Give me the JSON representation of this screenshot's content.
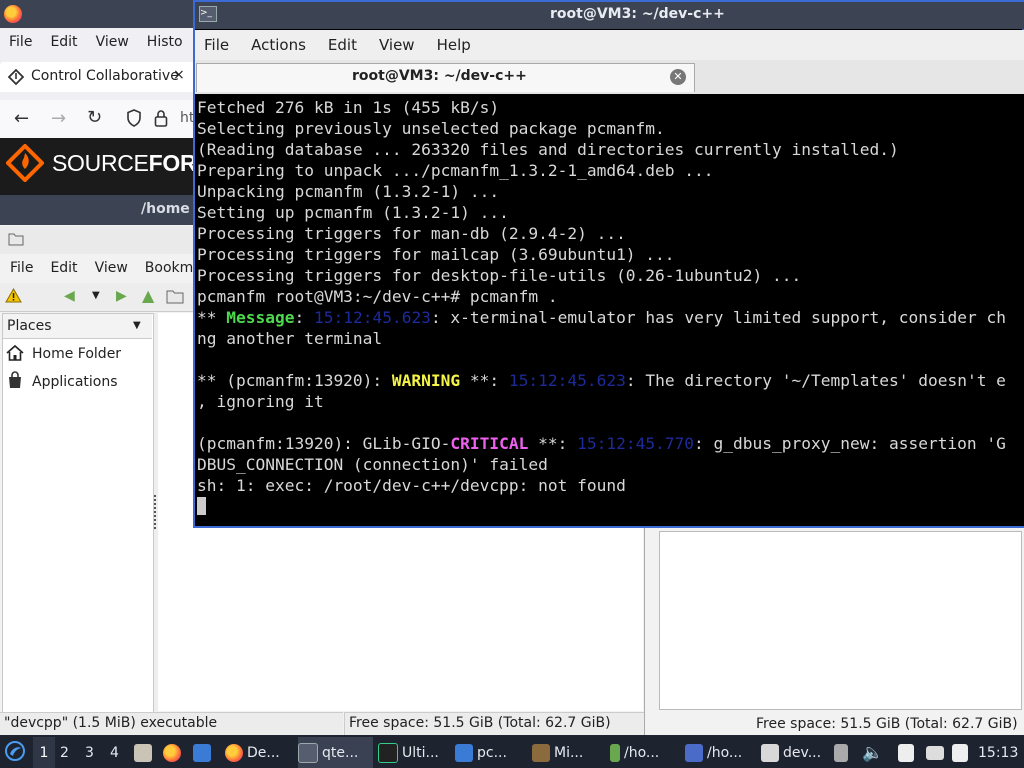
{
  "firefox": {
    "menu": [
      "File",
      "Edit",
      "View",
      "Histo"
    ],
    "tab_title": "Control Collaborative",
    "tab_close": "×",
    "url_fragment": "ht",
    "banner_text_light": "SOURCE",
    "banner_text_bold": "FOR"
  },
  "file_manager": {
    "title": "/home",
    "menu": [
      "File",
      "Edit",
      "View",
      "Bookma"
    ],
    "places_label": "Places",
    "places": [
      {
        "icon": "home-icon",
        "label": "Home Folder"
      },
      {
        "icon": "applications-icon",
        "label": "Applications"
      }
    ],
    "status_selection": "\"devcpp\" (1.5 MiB) executable",
    "status_free": "Free space: 51.5 GiB (Total: 62.7 GiB)"
  },
  "file_manager_2": {
    "status_free": "Free space: 51.5 GiB (Total: 62.7 GiB)"
  },
  "terminal": {
    "window_title": "root@VM3: ~/dev-c++",
    "menu": [
      "File",
      "Actions",
      "Edit",
      "View",
      "Help"
    ],
    "tab_title": "root@VM3: ~/dev-c++",
    "lines": [
      "Fetched 276 kB in 1s (455 kB/s)",
      "Selecting previously unselected package pcmanfm.",
      "(Reading database ... 263320 files and directories currently installed.)",
      "Preparing to unpack .../pcmanfm_1.3.2-1_amd64.deb ...",
      "Unpacking pcmanfm (1.3.2-1) ...",
      "Setting up pcmanfm (1.3.2-1) ...",
      "Processing triggers for man-db (2.9.4-2) ...",
      "Processing triggers for mailcap (3.69ubuntu1) ...",
      "Processing triggers for desktop-file-utils (0.26-1ubuntu2) ...",
      "pcmanfm root@VM3:~/dev-c++# pcmanfm ."
    ],
    "msg": {
      "prefix": "** ",
      "tag": "Message",
      "sep": ": ",
      "time": "15:12:45.623",
      "text": ": x-terminal-emulator has very limited support, consider ch",
      "cont": "ng another terminal"
    },
    "warning": {
      "prefix": "** (pcmanfm:13920): ",
      "tag": "WARNING",
      "mid": " **: ",
      "time": "15:12:45.623",
      "text": ": The directory '~/Templates' doesn't e",
      "cont": ", ignoring it"
    },
    "critical": {
      "prefix": "(pcmanfm:13920): GLib-GIO-",
      "tag": "CRITICAL",
      "mid": " **: ",
      "time": "15:12:45.770",
      "text": ": g_dbus_proxy_new: assertion 'G",
      "cont": "DBUS_CONNECTION (connection)' failed"
    },
    "last_line": "sh: 1: exec: /root/dev-c++/devcpp: not found"
  },
  "taskbar": {
    "workspaces": [
      "1",
      "2",
      "3",
      "4"
    ],
    "tasks": [
      {
        "icon": "firefox-icon",
        "label": "De..."
      },
      {
        "icon": "terminal-icon",
        "label": "qte..."
      },
      {
        "icon": "monitor-icon",
        "label": "Ulti..."
      },
      {
        "icon": "folder-icon",
        "label": "pc..."
      },
      {
        "icon": "minecraft-icon",
        "label": "Mi..."
      },
      {
        "icon": "text-editor-icon",
        "label": "/ho..."
      },
      {
        "icon": "text-editor-icon",
        "label": "/ho..."
      },
      {
        "icon": "folder-icon",
        "label": "dev..."
      }
    ],
    "clock": "15:13"
  },
  "colors": {
    "terminal_bg": "#000000",
    "message_green": "#4dd94d",
    "warning_yellow": "#f5f547",
    "critical_magenta": "#f060f0",
    "timestamp_blue": "#1d2a9a",
    "titlebar": "#3c4352",
    "taskbar": "#1e2330",
    "active_border": "#3d6bd6"
  }
}
